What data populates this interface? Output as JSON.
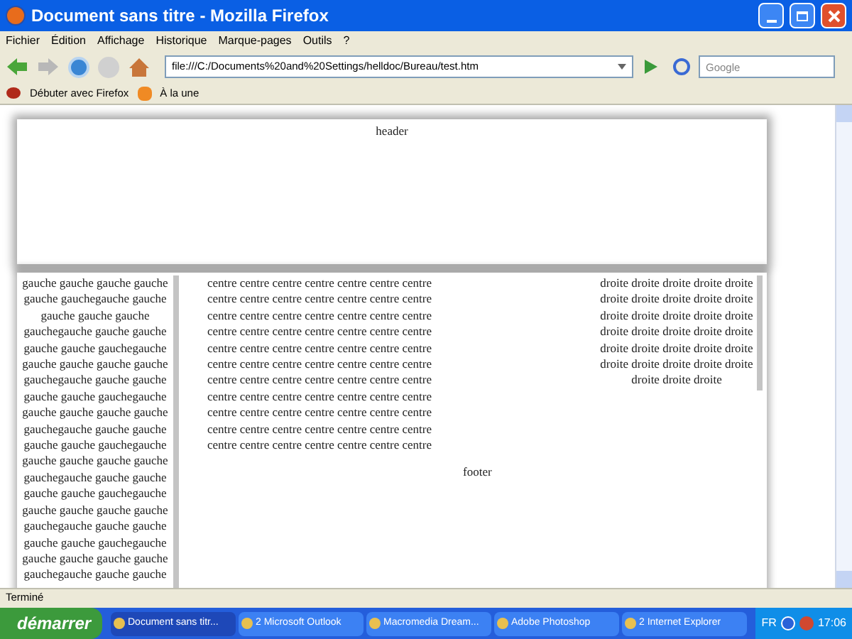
{
  "window": {
    "title": "Document sans titre - Mozilla Firefox"
  },
  "menu": [
    "Fichier",
    "Édition",
    "Affichage",
    "Historique",
    "Marque-pages",
    "Outils",
    "?"
  ],
  "address": {
    "value": "file:///C:/Documents%20and%20Settings/helldoc/Bureau/test.htm"
  },
  "search": {
    "placeholder": "Google"
  },
  "bookmarks": [
    "Débuter avec Firefox",
    "À la une"
  ],
  "page": {
    "header": "header",
    "gauche": [
      "gauche gauche gauche gauche",
      "gauche gauchegauche gauche",
      "gauche gauche gauche",
      "gauchegauche gauche gauche",
      "gauche gauche gauchegauche",
      "gauche gauche gauche gauche",
      "gauchegauche gauche gauche",
      "gauche gauche gauchegauche",
      "gauche gauche gauche gauche",
      "gauchegauche gauche gauche",
      "gauche gauche gauchegauche",
      "gauche gauche gauche gauche",
      "gauchegauche gauche gauche",
      "gauche gauche gauchegauche",
      "gauche gauche gauche gauche",
      "gauchegauche gauche gauche",
      "gauche gauche gauchegauche",
      "gauche gauche gauche gauche",
      "gauchegauche gauche gauche"
    ],
    "centre": [
      "centre centre centre centre centre centre centre",
      "centre centre centre centre centre centre centre",
      "centre centre centre centre centre centre centre",
      "centre centre centre centre centre centre centre",
      "centre centre centre centre centre centre centre",
      "centre centre centre centre centre centre centre",
      "centre centre centre centre centre centre centre",
      "centre centre centre centre centre centre centre",
      "centre centre centre centre centre centre centre",
      "centre centre centre centre centre centre centre",
      "centre centre centre centre centre centre centre"
    ],
    "droite": [
      "droite droite droite droite droite",
      "droite droite droite droite droite",
      "droite droite droite droite droite",
      "droite droite droite droite droite",
      "droite droite droite droite droite",
      "droite droite droite droite droite",
      "droite droite droite"
    ],
    "footer": "footer"
  },
  "status_bar": "Terminé",
  "taskbar": {
    "start": "démarrer",
    "tasks": [
      {
        "label": "Document sans titr...",
        "selected": true
      },
      {
        "label": "2 Microsoft Outlook",
        "selected": false
      },
      {
        "label": "Macromedia Dream...",
        "selected": false
      },
      {
        "label": "Adobe Photoshop",
        "selected": false
      },
      {
        "label": "2 Internet Explorer",
        "selected": false
      }
    ],
    "language": "FR",
    "clock": "17:06"
  }
}
